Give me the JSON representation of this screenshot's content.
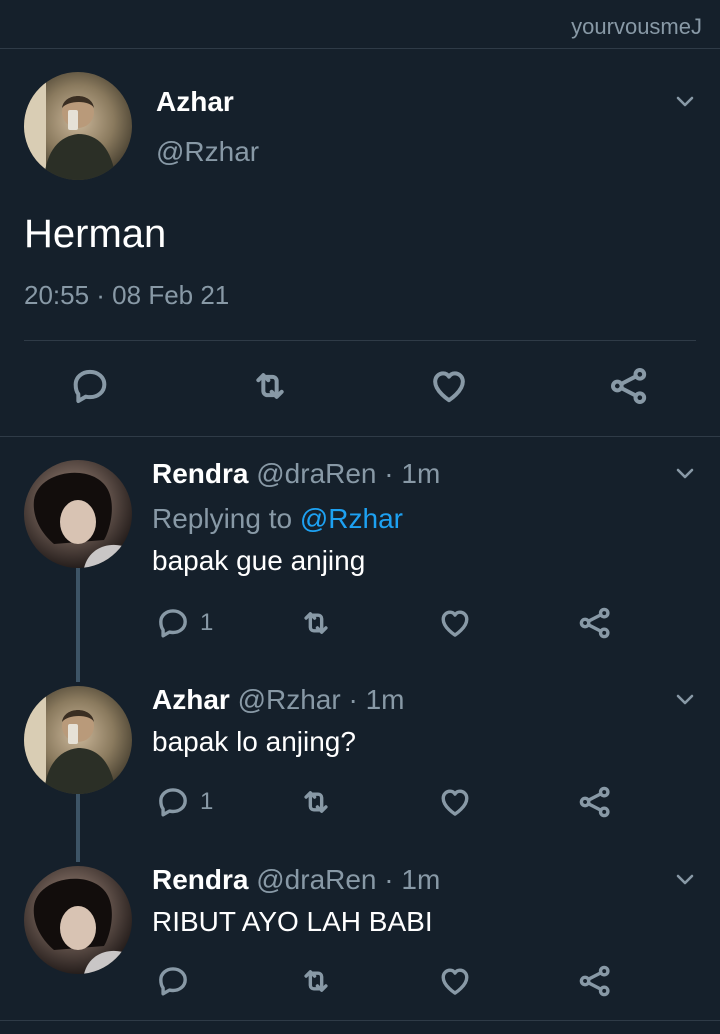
{
  "watermark": "yourvousmeJ",
  "main_tweet": {
    "name": "Azhar",
    "handle": "@Rzhar",
    "text": "Herman",
    "timestamp": "20:55 · 08 Feb 21"
  },
  "replies": [
    {
      "name": "Rendra",
      "handle": "@draRen",
      "time": "· 1m",
      "replying_label": "Replying to",
      "replying_to": "@Rzhar",
      "text": "bapak gue anjing",
      "reply_count": "1"
    },
    {
      "name": "Azhar",
      "handle": "@Rzhar",
      "time": "· 1m",
      "text": "bapak lo anjing?",
      "reply_count": "1"
    },
    {
      "name": "Rendra",
      "handle": "@draRen",
      "time": "· 1m",
      "text": "RIBUT AYO LAH BABI",
      "reply_count": ""
    }
  ],
  "icons": {
    "reply": "reply-icon",
    "retweet": "retweet-icon",
    "like": "heart-icon",
    "share": "share-icon",
    "menu": "chevron-down-icon"
  },
  "colors": {
    "background": "#15202b",
    "secondary_text": "#8899a6",
    "link": "#1da1f2",
    "divider": "#2f3b47"
  }
}
